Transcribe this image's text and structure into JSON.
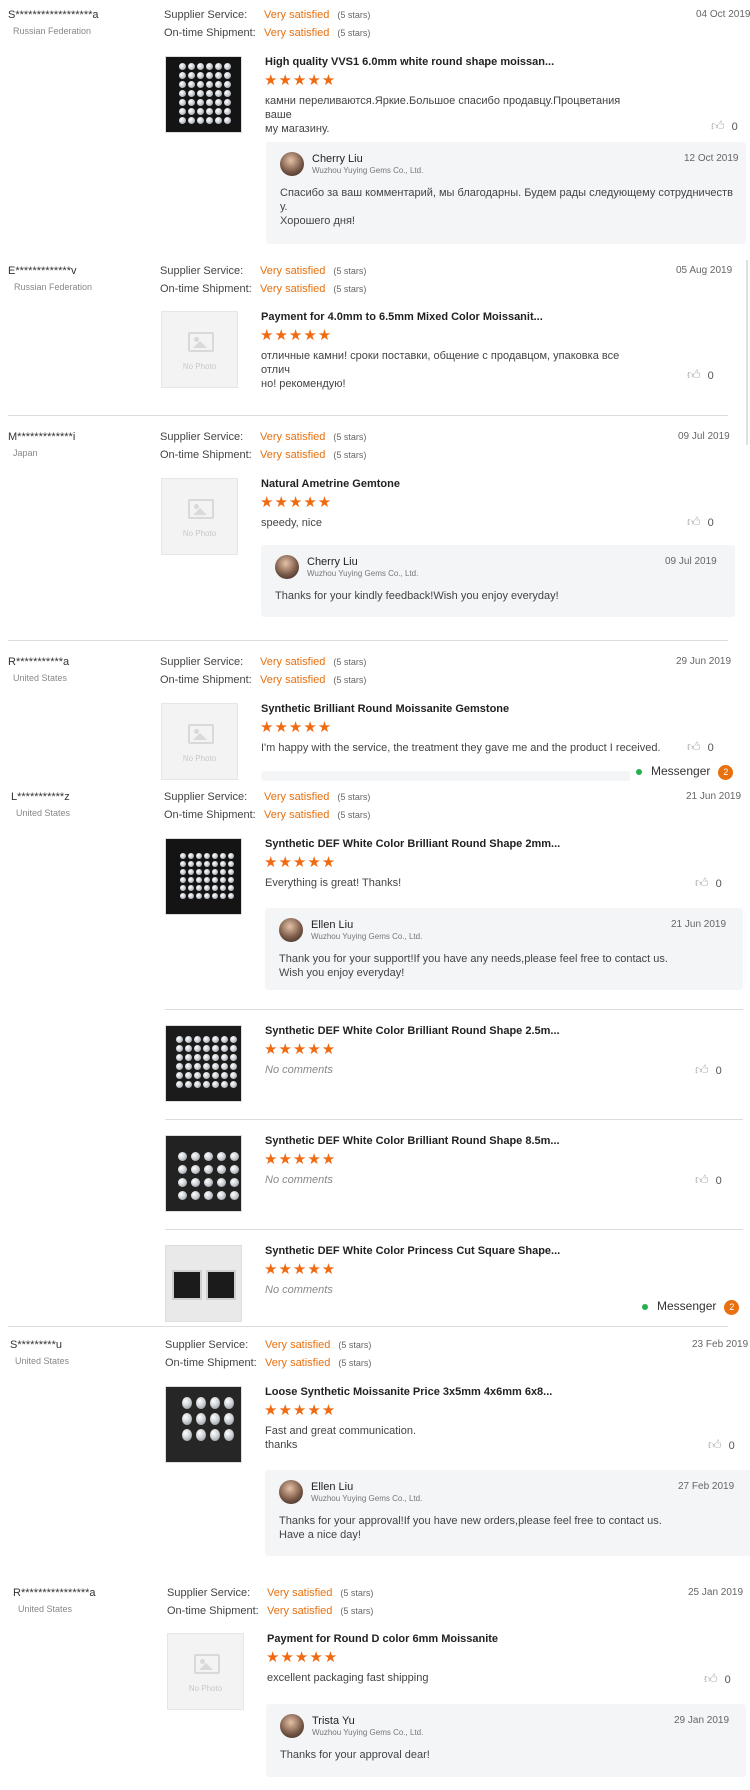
{
  "labels": {
    "supplier_service": "Supplier Service:",
    "on_time_shipment": "On-time Shipment:",
    "rating_value": "Very satisfied",
    "rating_stars": "(5 stars)",
    "stars": "★★★★★",
    "no_photo": "No Photo",
    "no_comments": "No comments",
    "helpful_count": "0",
    "company": "Wuzhou Yuying Gems Co., Ltd."
  },
  "icons": {
    "like": "thumbs-up-icon",
    "placeholder": "image-placeholder-icon",
    "online": "online-dot-icon"
  },
  "colors": {
    "rating_orange": "#e8700f",
    "star_orange": "#f06a12",
    "online_green": "#23b14d"
  },
  "messenger": {
    "label": "Messenger",
    "count": "2"
  },
  "reviews": [
    {
      "buyer": "S******************a",
      "country": "Russian Federation",
      "date": "04 Oct 2019",
      "products": [
        {
          "title": "High quality VVS1 6.0mm white round shape moissan...",
          "comment": "камни переливаются.Яркие.Большое спасибо продавцу.Процветания ваше\nму магазину."
        }
      ],
      "reply": {
        "name": "Cherry Liu",
        "date": "12 Oct 2019",
        "text": "Спасибо за ваш комментарий, мы благодарны. Будем рады следующему сотрудничеств\nу.\nХорошего дня!"
      }
    },
    {
      "buyer": "E*************v",
      "country": "Russian Federation",
      "date": "05 Aug 2019",
      "products": [
        {
          "title": "Payment for 4.0mm to 6.5mm Mixed Color Moissanit...",
          "comment": "отличные камни! сроки поставки, общение с продавцом, упаковка все отлич\nно! рекомендую!"
        }
      ]
    },
    {
      "buyer": "M*************i",
      "country": "Japan",
      "date": "09 Jul 2019",
      "products": [
        {
          "title": "Natural Ametrine Gemtone",
          "comment": "speedy, nice"
        }
      ],
      "reply": {
        "name": "Cherry Liu",
        "date": "09 Jul 2019",
        "text": "Thanks for your kindly feedback!Wish you enjoy everyday!"
      }
    },
    {
      "buyer": "R***********a",
      "country": "United States",
      "date": "29 Jun 2019",
      "products": [
        {
          "title": "Synthetic Brilliant Round Moissanite Gemstone",
          "comment": "I'm happy with the service, the treatment they gave me and the product I received."
        }
      ]
    },
    {
      "buyer": "L***********z",
      "country": "United States",
      "date": "21 Jun 2019",
      "products": [
        {
          "title": "Synthetic DEF White Color Brilliant Round Shape 2mm...",
          "comment": "Everything is great!  Thanks!"
        },
        {
          "title": "Synthetic DEF White Color Brilliant Round Shape 2.5m..."
        },
        {
          "title": "Synthetic DEF White Color Brilliant Round Shape 8.5m..."
        },
        {
          "title": "Synthetic DEF White Color Princess Cut Square Shape..."
        }
      ],
      "reply": {
        "name": "Ellen Liu",
        "date": "21 Jun 2019",
        "text": "Thank you for your support!If you have any needs,please feel free to contact us.\nWish you enjoy everyday!"
      }
    },
    {
      "buyer": "S*********u",
      "country": "United States",
      "date": "23 Feb 2019",
      "products": [
        {
          "title": "Loose Synthetic Moissanite Price 3x5mm 4x6mm 6x8...",
          "comment": "Fast and great communication.\nthanks"
        }
      ],
      "reply": {
        "name": "Ellen Liu",
        "date": "27 Feb 2019",
        "text": "Thanks for your approval!If you have new orders,please feel free to contact us.\nHave a nice day!"
      }
    },
    {
      "buyer": "R****************a",
      "country": "United States",
      "date": "25 Jan 2019",
      "products": [
        {
          "title": "Payment for Round D color 6mm Moissanite",
          "comment": "excellent packaging fast shipping"
        }
      ],
      "reply": {
        "name": "Trista Yu",
        "date": "29 Jan 2019",
        "text": "Thanks for your approval dear!"
      }
    }
  ]
}
